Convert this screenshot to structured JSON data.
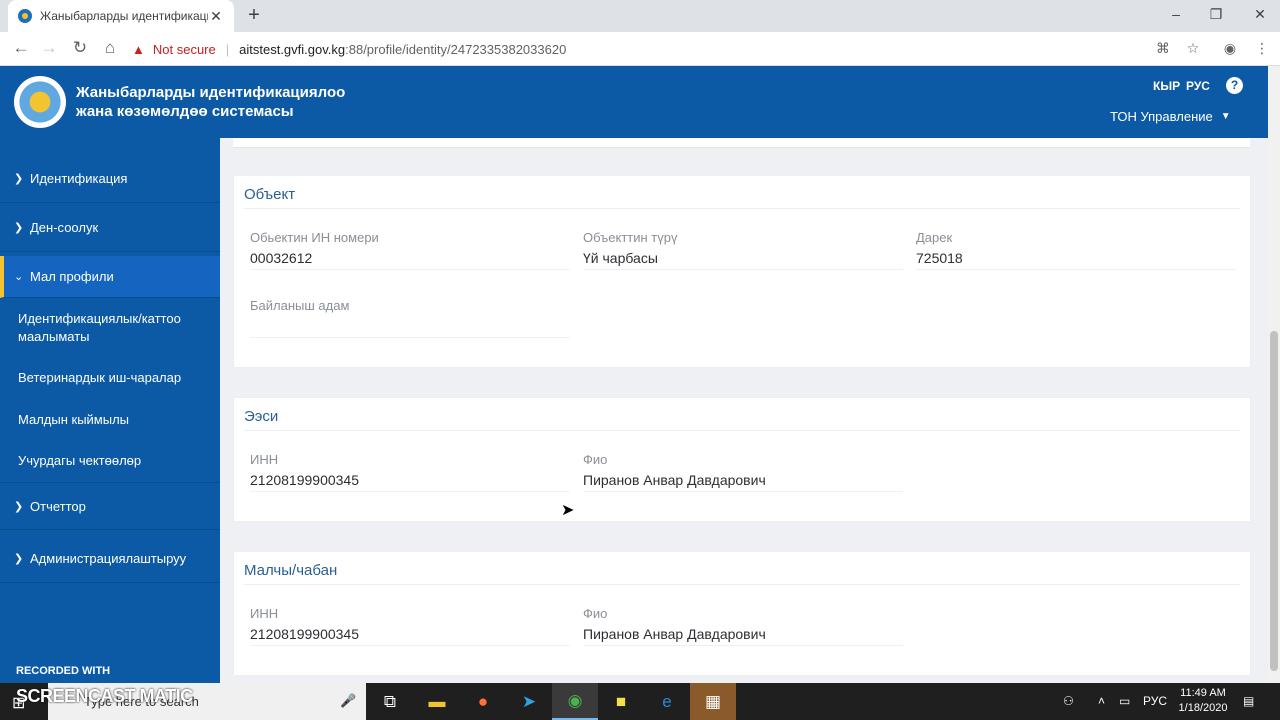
{
  "browser": {
    "tab_title": "Жаныбарларды идентификациялоо",
    "tab_close": "✕",
    "new_tab": "+",
    "security_label": "Not secure",
    "url_host": "aitstest.gvfi.gov.kg",
    "url_path": ":88/profile/identity/2472335382033620",
    "window_controls": [
      "–",
      "❐",
      "✕"
    ],
    "icons": [
      "back-icon",
      "forward-icon",
      "reload-icon",
      "home-icon",
      "translate-icon",
      "star-icon",
      "extension-icon",
      "menu-icon"
    ]
  },
  "header": {
    "title_line1": "Жаныбарларды идентификациялоо",
    "title_line2": "жана көзөмөлдөө системасы",
    "lang_ky": "КЫР",
    "lang_ru": "РУС",
    "help": "?",
    "user": "ТОН Управление",
    "accent_color": "#0c5aa5"
  },
  "sidebar": {
    "items": [
      {
        "label": "Идентификация"
      },
      {
        "label": "Ден-соолук"
      },
      {
        "label": "Мал профили"
      },
      {
        "label": "Отчеттор"
      },
      {
        "label": "Администрациялаштыруу"
      }
    ],
    "subitems": [
      {
        "label": "Идентификациялык/каттоо маалыматы"
      },
      {
        "label": "Ветеринардык иш-чаралар"
      },
      {
        "label": "Малдын кыймылы"
      },
      {
        "label": "Учурдагы чектөөлөр"
      }
    ],
    "recorded_with": "RECORDED WITH"
  },
  "object_card": {
    "title": "Объект",
    "id_label": "Обьектин ИН номери",
    "id_value": "00032612",
    "type_label": "Объекттин түрү",
    "type_value": "Үй чарбасы",
    "address_label": "Дарек",
    "address_value": "725018",
    "contact_label": "Байланыш адам",
    "contact_value": ""
  },
  "owner_card": {
    "title": "Ээси",
    "inn_label": "ИНН",
    "inn_value": "21208199900345",
    "fio_label": "Фио",
    "fio_value": "Пиранов Анвар Давдарович"
  },
  "herder_card": {
    "title": "Малчы/чабан",
    "inn_label": "ИНН",
    "inn_value": "21208199900345",
    "fio_label": "Фио",
    "fio_value": "Пиранов Анвар Давдарович"
  },
  "taskbar": {
    "search_placeholder": "Type here to search",
    "watermark": "SCREENCAST MATIC",
    "lang": "РУС",
    "time": "11:49 AM",
    "date": "1/18/2020"
  }
}
